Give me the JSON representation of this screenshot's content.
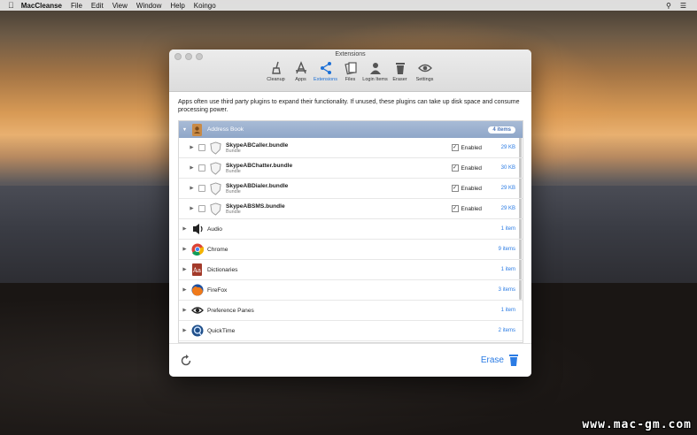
{
  "menubar": {
    "app_name": "MacCleanse",
    "items": [
      "File",
      "Edit",
      "View",
      "Window",
      "Help",
      "Koingo"
    ]
  },
  "window": {
    "title": "Extensions",
    "toolbar": [
      {
        "label": "Cleanup",
        "icon": "broom-icon"
      },
      {
        "label": "Apps",
        "icon": "apps-icon"
      },
      {
        "label": "Extensions",
        "icon": "share-icon",
        "selected": true
      },
      {
        "label": "Files",
        "icon": "files-icon"
      },
      {
        "label": "Login Items",
        "icon": "person-icon"
      },
      {
        "label": "Eraser",
        "icon": "trash-icon"
      },
      {
        "label": "Settings",
        "icon": "eye-icon"
      }
    ],
    "description": "Apps often use third party plugins to expand their functionality. If unused, these plugins can take up disk space and consume processing power.",
    "groups": [
      {
        "name": "Address Book",
        "count": "4 items",
        "expanded": true,
        "items": [
          {
            "name": "SkypeABCaller.bundle",
            "type": "Bundle",
            "status": "Enabled",
            "size": "29 KB"
          },
          {
            "name": "SkypeABChatter.bundle",
            "type": "Bundle",
            "status": "Enabled",
            "size": "30 KB"
          },
          {
            "name": "SkypeABDialer.bundle",
            "type": "Bundle",
            "status": "Enabled",
            "size": "29 KB"
          },
          {
            "name": "SkypeABSMS.bundle",
            "type": "Bundle",
            "status": "Enabled",
            "size": "29 KB"
          }
        ]
      },
      {
        "name": "Audio",
        "count": "1 item"
      },
      {
        "name": "Chrome",
        "count": "9 items"
      },
      {
        "name": "Dictionaries",
        "count": "1 item"
      },
      {
        "name": "FireFox",
        "count": "3 items"
      },
      {
        "name": "Preference Panes",
        "count": "1 item"
      },
      {
        "name": "QuickTime",
        "count": "2 items"
      }
    ],
    "footer": {
      "erase_label": "Erase"
    }
  },
  "watermark": "www.mac-gm.com",
  "colors": {
    "accent": "#2a7be4",
    "header_row": "#98adcd"
  }
}
